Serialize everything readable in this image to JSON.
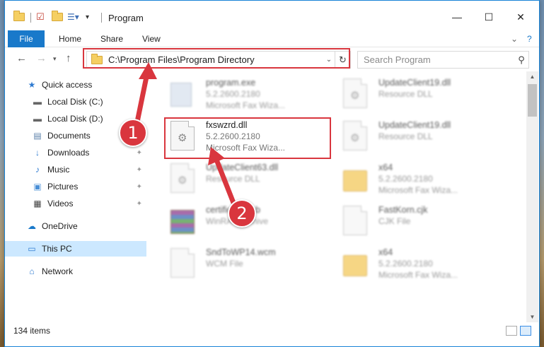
{
  "window": {
    "title": "Program",
    "controls": {
      "minimize": "—",
      "maximize": "☐",
      "close": "✕"
    }
  },
  "ribbon": {
    "tabs": [
      "File",
      "Home",
      "Share",
      "View"
    ],
    "help_icon": "?",
    "expand_icon": "⌄"
  },
  "address": {
    "path": "C:\\Program Files\\Program Directory",
    "search_placeholder": "Search Program"
  },
  "nav": {
    "items": [
      {
        "label": "Quick access",
        "icon": "star-icon",
        "pinned": false
      },
      {
        "label": "Local Disk (C:)",
        "icon": "drive-icon",
        "pinned": false
      },
      {
        "label": "Local Disk (D:)",
        "icon": "drive-icon",
        "pinned": false
      },
      {
        "label": "Documents",
        "icon": "documents-icon",
        "pinned": true
      },
      {
        "label": "Downloads",
        "icon": "downloads-icon",
        "pinned": true
      },
      {
        "label": "Music",
        "icon": "music-icon",
        "pinned": true
      },
      {
        "label": "Pictures",
        "icon": "pictures-icon",
        "pinned": true
      },
      {
        "label": "Videos",
        "icon": "videos-icon",
        "pinned": true
      },
      {
        "label": "OneDrive",
        "icon": "onedrive-icon",
        "pinned": false
      },
      {
        "label": "This PC",
        "icon": "pc-icon",
        "pinned": false,
        "selected": true
      },
      {
        "label": "Network",
        "icon": "network-icon",
        "pinned": false
      }
    ]
  },
  "files": [
    {
      "name": "program.exe",
      "meta1": "5.2.2600.2180",
      "meta2": "Microsoft  Fax Wiza...",
      "kind": "exe"
    },
    {
      "name": "UpdateClient19.dll",
      "meta1": "Resource DLL",
      "meta2": "",
      "kind": "dll"
    },
    {
      "name": "fxswzrd.dll",
      "meta1": "5.2.2600.2180",
      "meta2": "Microsoft  Fax Wiza...",
      "kind": "dll"
    },
    {
      "name": "UpdateClient19.dll",
      "meta1": "Resource DLL",
      "meta2": "",
      "kind": "dll"
    },
    {
      "name": "UpdateClient63.dll",
      "meta1": "Resource DLL",
      "meta2": "",
      "kind": "dll"
    },
    {
      "name": "x64",
      "meta1": "5.2.2600.2180",
      "meta2": "Microsoft  Fax Wiza...",
      "kind": "folder"
    },
    {
      "name": "certificate.cab",
      "meta1": "WinRAR archive",
      "meta2": "",
      "kind": "zip"
    },
    {
      "name": "FastKorn.cjk",
      "meta1": "CJK File",
      "meta2": "",
      "kind": "file"
    },
    {
      "name": "SndToWP14.wcm",
      "meta1": "WCM File",
      "meta2": "",
      "kind": "file"
    },
    {
      "name": "x64",
      "meta1": "5.2.2600.2180",
      "meta2": "Microsoft  Fax Wiza...",
      "kind": "folder"
    }
  ],
  "status": {
    "item_count": "134 items"
  },
  "annotations": {
    "step1": "1",
    "step2": "2",
    "color": "#d9363e"
  }
}
